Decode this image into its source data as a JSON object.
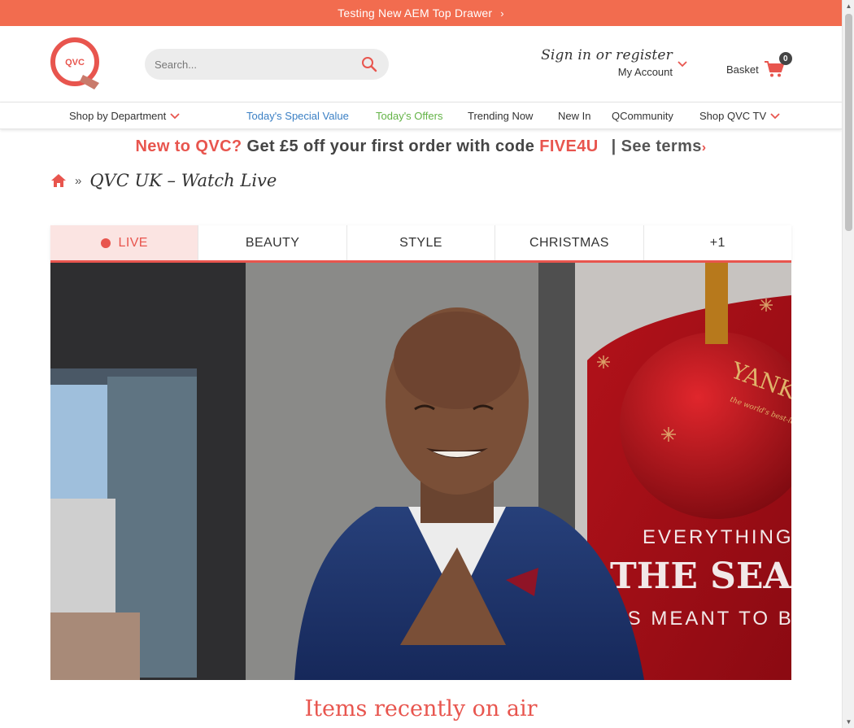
{
  "top_drawer": {
    "text": "Testing New AEM Top Drawer",
    "chevron": "›"
  },
  "header": {
    "logo_text": "QVC",
    "search": {
      "placeholder": "Search..."
    },
    "account": {
      "signin": "Sign in or register",
      "my_account": "My Account"
    },
    "basket": {
      "label": "Basket",
      "count": "0"
    }
  },
  "nav": {
    "shop_by_department": "Shop by Department",
    "todays_special_value": "Today's Special Value",
    "todays_offers": "Today's Offers",
    "trending_now": "Trending Now",
    "new_in": "New In",
    "qcommunity": "QCommunity",
    "shop_qvc_tv": "Shop QVC TV",
    "chevron": "❯"
  },
  "promo": {
    "new": "New to QVC?",
    "text": "Get £5 off your first order with code",
    "code": "FIVE4U",
    "terms": "| See terms",
    "terms_arrow": "›"
  },
  "breadcrumb": {
    "separator": "»",
    "title": "QVC UK – Watch Live"
  },
  "tabs": [
    {
      "label": "LIVE"
    },
    {
      "label": "BEAUTY"
    },
    {
      "label": "STYLE"
    },
    {
      "label": "CHRISTMAS"
    },
    {
      "label": "+1"
    }
  ],
  "video": {
    "ornament_brand": "YANKEE CANDLE",
    "ornament_tagline": "the world's best-loved candle",
    "banner_line1": "EVERYTHING",
    "banner_line2": "THE SEASON",
    "banner_line3": "IS MEANT TO BE"
  },
  "section_heading": "Items recently on air",
  "colors": {
    "brand": "#f26c4f",
    "accent": "#e8554e",
    "link_blue": "#3a7fc4",
    "link_green": "#63b346"
  },
  "icons": [
    "qvc-logo-icon",
    "search-icon",
    "chevron-down-icon",
    "cart-icon",
    "home-icon",
    "live-dot-icon",
    "chevron-right-icon"
  ]
}
